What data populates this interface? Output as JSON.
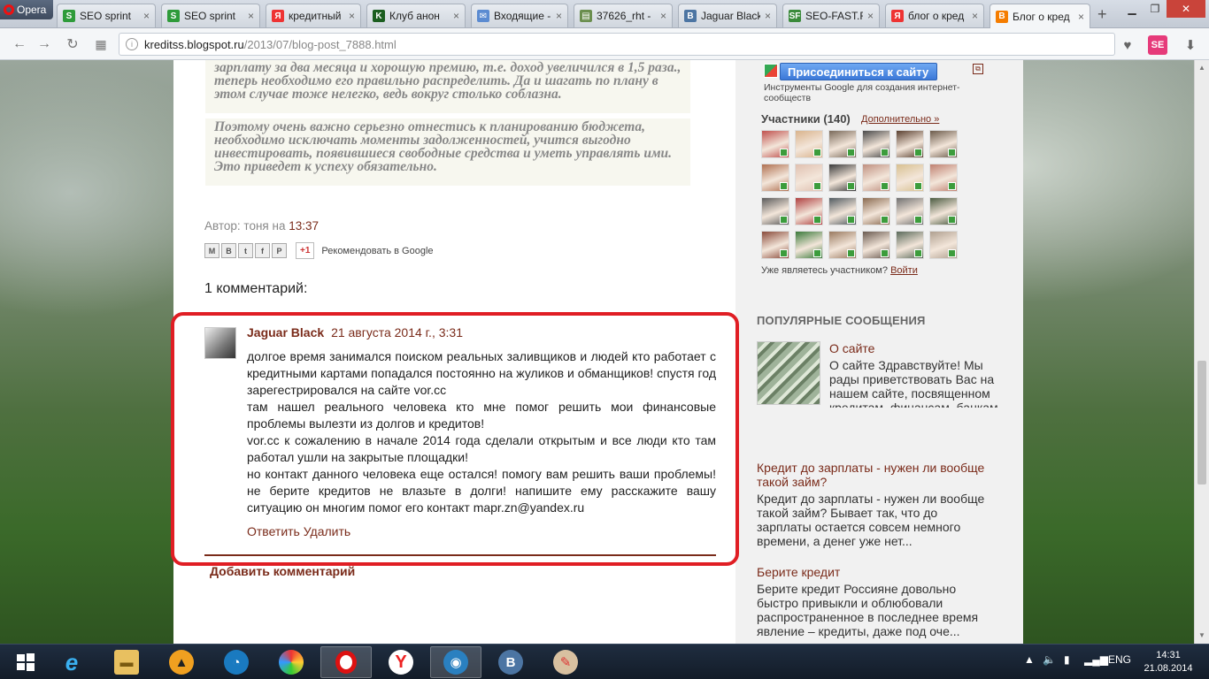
{
  "browser": {
    "menu_label": "Opera",
    "tabs": [
      {
        "label": "SEO sprint",
        "icon": "seosprint-icon",
        "color": "#2e9b3a",
        "glyph": "S"
      },
      {
        "label": "SEO sprint",
        "icon": "seosprint-icon",
        "color": "#2e9b3a",
        "glyph": "S"
      },
      {
        "label": "кредитный",
        "icon": "yandex-icon",
        "color": "#e33",
        "glyph": "Я"
      },
      {
        "label": "Клуб анон",
        "icon": "club-icon",
        "color": "#1b5e20",
        "glyph": "K"
      },
      {
        "label": "Входящие -",
        "icon": "mail-icon",
        "color": "#5b8bd1",
        "glyph": "✉"
      },
      {
        "label": "37626_rht -",
        "icon": "file-icon",
        "color": "#6a8e4e",
        "glyph": "▤"
      },
      {
        "label": "Jaguar Black",
        "icon": "vk-icon",
        "color": "#4c75a3",
        "glyph": "B"
      },
      {
        "label": "SEO-FAST.R",
        "icon": "seofast-icon",
        "color": "#3a8a3a",
        "glyph": "SF"
      },
      {
        "label": "блог о кред",
        "icon": "yandex-icon",
        "color": "#e33",
        "glyph": "Я"
      },
      {
        "label": "Блог о кред",
        "icon": "blogger-icon",
        "color": "#f57d00",
        "glyph": "B"
      }
    ],
    "url_host": "kreditss.blogspot.ru",
    "url_path": "/2013/07/blog-post_7888.html"
  },
  "article": {
    "quote1": "зарплату за два месяца и хорошую премию, т.е. доход увеличился в 1,5 раза., теперь необходимо его правильно распределить. Да и шагать по плану в этом случае тоже нелегко, ведь вокруг столько соблазна.",
    "quote2": "Поэтому очень важно серьезно отнестись к планированию бюджета, необходимо исключать моменты задолженностей, учится выгодно инвестировать, появившиеся свободные средства и уметь управлять ими. Это приведет к успеху обязательно.",
    "author_prefix": "Автор: тоня на",
    "author_time": "13:37",
    "gplus_label": "+1",
    "recommend": "Рекомендовать в Google",
    "comments_title": "1 комментарий:"
  },
  "comment": {
    "author": "Jaguar Black",
    "date": "21 августа 2014 г., 3:31",
    "lines": [
      "долгое время занимался поиском реальных заливщиков и людей кто работает с кредитными картами попадался постоянно на жуликов и обманщиков! спустя год зарегестрировался на сайте vor.cc",
      "там нашел реального человека кто мне помог решить мои финансовые проблемы вылезти из долгов и кредитов!",
      "vor.cc к сожалению в начале 2014 года сделали открытым и все люди кто там работал ушли на закрытые площадки!",
      "но контакт данного человека еще остался! помогу вам решить ваши проблемы! не берите кредитов не влазьте в долги! напишите ему расскажите вашу ситуацию он многим помог его контакт mapr.zn@yandex.ru"
    ],
    "reply": "Ответить",
    "delete": "Удалить",
    "add_comment": "Добавить комментарий"
  },
  "sidebar": {
    "join_button": "Присоединиться к сайту",
    "tools_text": "Инструменты Google для создания интернет-сообществ",
    "members_title": "Участники (140)",
    "members_more": "Дополнительно »",
    "member_colors": [
      "#c0504d",
      "#d9b38c",
      "#7a6a5a",
      "#4a4a4a",
      "#5a4030",
      "#6b5a4a",
      "#b07050",
      "#e0c0b0",
      "#3a3a3a",
      "#c09080",
      "#d8c090",
      "#c08070",
      "#5a5a5a",
      "#b04040",
      "#505a60",
      "#8a6a50",
      "#707070",
      "#4a5a40",
      "#8a4a3a",
      "#3a7a3a",
      "#9a7a60",
      "#6a5a50",
      "#5a6a5a",
      "#b0a090"
    ],
    "already_member": "Уже являетесь участником?",
    "login": "Войти",
    "popular_title": "ПОПУЛЯРНЫЕ СООБЩЕНИЯ",
    "posts": [
      {
        "title": "О сайте",
        "text": "О сайте Здравствуйте! Мы рады приветствовать Вас на нашем сайте, посвященном кредитам, финансам, банкам и всей финансовой индустрии..."
      },
      {
        "title": "Кредит до зарплаты - нужен ли вообще такой займ?",
        "text": "Кредит до зарплаты - нужен ли вообще такой займ? Бывает так, что   до зарплаты   остается совсем немного времени, а денег уже нет..."
      },
      {
        "title": "Берите кредит",
        "text": "Берите кредит Россияне довольно быстро привыкли и облюбовали распространенное в последнее время явление – кредиты, даже под оче..."
      }
    ]
  },
  "taskbar": {
    "language": "ENG",
    "time": "14:31",
    "date": "21.08.2014"
  }
}
